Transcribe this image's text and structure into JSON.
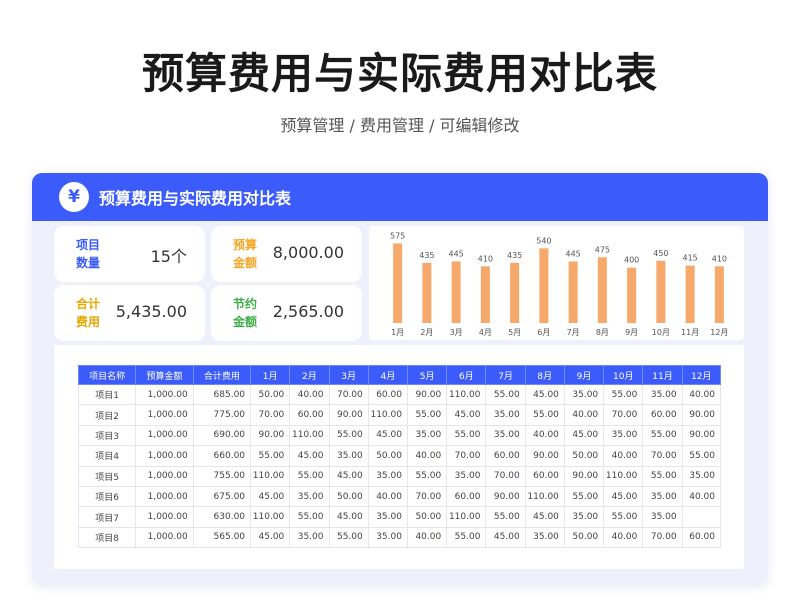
{
  "page": {
    "title": "预算费用与实际费用对比表",
    "subtitle": "预算管理 / 费用管理 /  可编辑修改"
  },
  "card": {
    "header_icon": "yen-icon",
    "header_icon_glyph": "¥",
    "header_title": "预算费用与实际费用对比表"
  },
  "stats": {
    "item_count": {
      "label": "项目数量",
      "value": "15个",
      "color": "#3b5bfa"
    },
    "budget_amount": {
      "label": "预算金额",
      "value": "8,000.00",
      "color": "#f5a623"
    },
    "total_cost": {
      "label": "合计费用",
      "value": "5,435.00",
      "color": "#e6a700"
    },
    "saving_amount": {
      "label": "节约金额",
      "value": "2,565.00",
      "color": "#3fae49"
    }
  },
  "colors": {
    "accent": "#3b5bfa",
    "bar": "#f7a96b",
    "card_bg": "#eef1fb"
  },
  "chart_data": {
    "type": "bar",
    "categories": [
      "1月",
      "2月",
      "3月",
      "4月",
      "5月",
      "6月",
      "7月",
      "8月",
      "9月",
      "10月",
      "11月",
      "12月"
    ],
    "values": [
      575,
      435,
      445,
      410,
      435,
      540,
      445,
      475,
      400,
      450,
      415,
      410
    ],
    "title": "",
    "xlabel": "",
    "ylabel": "",
    "ylim": [
      0,
      600
    ],
    "grid": false,
    "data_labels": true
  },
  "table": {
    "headers": [
      "项目名称",
      "预算金额",
      "合计费用",
      "1月",
      "2月",
      "3月",
      "4月",
      "5月",
      "6月",
      "7月",
      "8月",
      "9月",
      "10月",
      "11月",
      "12月"
    ],
    "rows": [
      [
        "项目1",
        "1,000.00",
        "685.00",
        "50.00",
        "40.00",
        "70.00",
        "60.00",
        "90.00",
        "110.00",
        "55.00",
        "45.00",
        "35.00",
        "55.00",
        "35.00",
        "40.00"
      ],
      [
        "项目2",
        "1,000.00",
        "775.00",
        "70.00",
        "60.00",
        "90.00",
        "110.00",
        "55.00",
        "45.00",
        "35.00",
        "55.00",
        "40.00",
        "70.00",
        "60.00",
        "90.00"
      ],
      [
        "项目3",
        "1,000.00",
        "690.00",
        "90.00",
        "110.00",
        "55.00",
        "45.00",
        "35.00",
        "55.00",
        "35.00",
        "40.00",
        "45.00",
        "35.00",
        "55.00",
        "90.00"
      ],
      [
        "项目4",
        "1,000.00",
        "660.00",
        "55.00",
        "45.00",
        "35.00",
        "50.00",
        "40.00",
        "70.00",
        "60.00",
        "90.00",
        "50.00",
        "40.00",
        "70.00",
        "55.00"
      ],
      [
        "项目5",
        "1,000.00",
        "755.00",
        "110.00",
        "55.00",
        "45.00",
        "35.00",
        "55.00",
        "35.00",
        "70.00",
        "60.00",
        "90.00",
        "110.00",
        "55.00",
        "35.00"
      ],
      [
        "项目6",
        "1,000.00",
        "675.00",
        "45.00",
        "35.00",
        "50.00",
        "40.00",
        "70.00",
        "60.00",
        "90.00",
        "110.00",
        "55.00",
        "45.00",
        "35.00",
        "40.00"
      ],
      [
        "项目7",
        "1,000.00",
        "630.00",
        "110.00",
        "55.00",
        "45.00",
        "35.00",
        "50.00",
        "110.00",
        "55.00",
        "45.00",
        "35.00",
        "55.00",
        "35.00",
        ""
      ],
      [
        "项目8",
        "1,000.00",
        "565.00",
        "45.00",
        "35.00",
        "55.00",
        "35.00",
        "40.00",
        "55.00",
        "45.00",
        "35.00",
        "50.00",
        "40.00",
        "70.00",
        "60.00"
      ]
    ]
  }
}
